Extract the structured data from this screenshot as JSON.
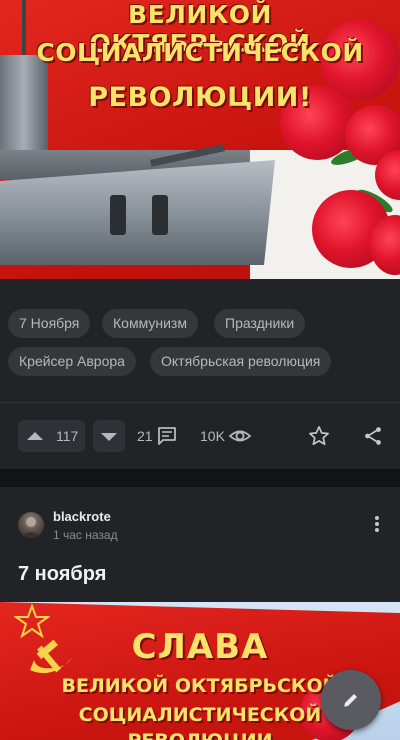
{
  "poster_top": {
    "line1": "ВЕЛИКОЙ ОКТЯБРЬСКОЙ",
    "line2": "СОЦИАЛИСТИЧЕСКОЙ",
    "line3": "РЕВОЛЮЦИИ!"
  },
  "tags": [
    "7 Ноября",
    "Коммунизм",
    "Праздники",
    "Крейсер Аврора",
    "Октябрьская революция"
  ],
  "actions": {
    "upvotes": "117",
    "comments": "21",
    "views": "10K"
  },
  "post": {
    "author": "blackrote",
    "time": "1 час назад",
    "title": "7 ноября"
  },
  "poster_bottom": {
    "line1": "СЛАВА",
    "line2": "ВЕЛИКОЙ ОКТЯБРЬСКОЙ",
    "line3": "СОЦИАЛИСТИЧЕСКОЙ",
    "line4": "РЕВОЛЮЦИИ"
  },
  "icons": {
    "upvote": "arrow-up-icon",
    "downvote": "arrow-down-icon",
    "comments": "comment-icon",
    "views": "eye-icon",
    "favorite": "star-icon",
    "share": "share-icon",
    "menu": "more-vertical-icon",
    "fab": "pencil-icon"
  },
  "colors": {
    "background": "#1a1b1e",
    "card": "#222326",
    "tag": "#36373b",
    "poster_red": "#d8201c",
    "poster_text": "#fbe36a"
  }
}
